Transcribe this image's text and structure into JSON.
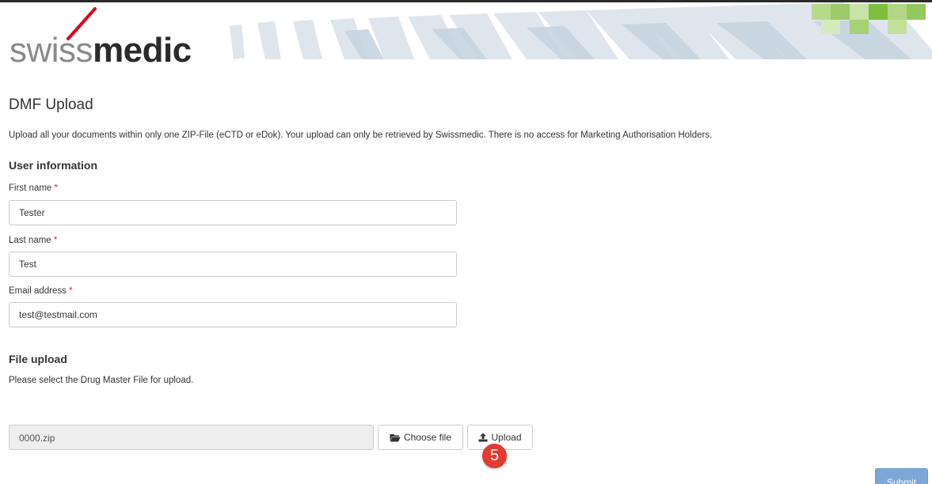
{
  "brand": {
    "logo_light": "swiss",
    "logo_bold": "medic",
    "accent": "#c9302c",
    "logo_slash_color": "#e0001b"
  },
  "page": {
    "title": "DMF Upload",
    "intro": "Upload all your documents within only one ZIP-File (eCTD or eDok). Your upload can only be retrieved by Swissmedic. There is no access for Marketing Authorisation Holders."
  },
  "user_info": {
    "heading": "User information",
    "first_name": {
      "label": "First name",
      "required_mark": "*",
      "value": "Tester"
    },
    "last_name": {
      "label": "Last name",
      "required_mark": "*",
      "value": "Test"
    },
    "email": {
      "label": "Email address",
      "required_mark": "*",
      "value": "test@testmail.com"
    }
  },
  "file_upload": {
    "heading": "File upload",
    "description": "Please select the Drug Master File for upload.",
    "file_name": "0000.zip",
    "choose_label": "Choose file",
    "choose_icon": "folder-open-icon",
    "upload_label": "Upload",
    "upload_icon": "upload-icon"
  },
  "annotation": {
    "step_number": "5",
    "color": "#e33a31"
  },
  "submit": {
    "label": "Submit",
    "color": "#7ea7d8"
  }
}
